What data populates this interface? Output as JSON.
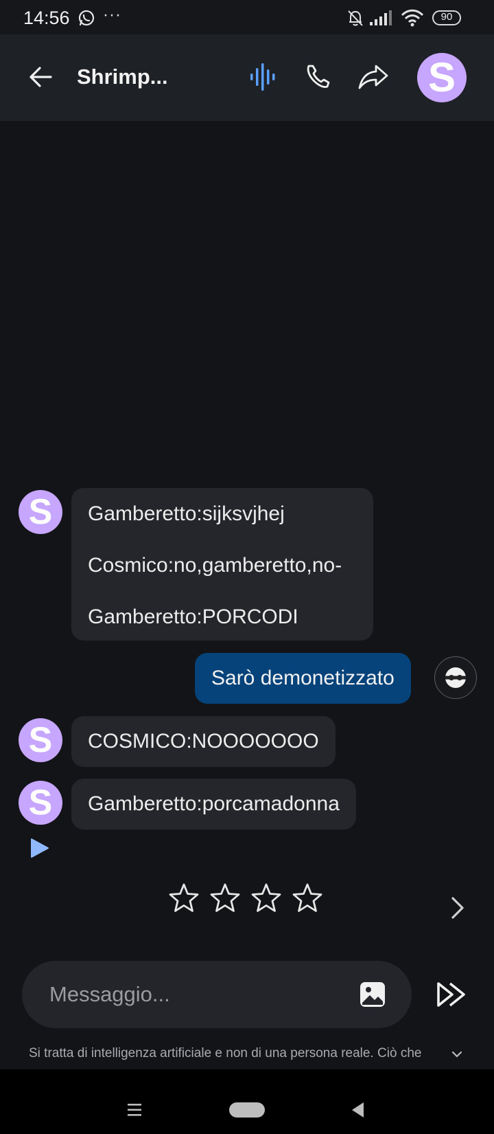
{
  "status_bar": {
    "time": "14:56",
    "dots": "···",
    "battery": "90",
    "icons": [
      "whatsapp-icon",
      "bell-off-icon",
      "signal-icon",
      "wifi-icon",
      "battery-icon"
    ]
  },
  "header": {
    "title": "Shrimp...",
    "avatar_letter": "S",
    "icons": [
      "back-arrow-icon",
      "voice-wave-icon",
      "phone-icon",
      "share-icon"
    ]
  },
  "messages": [
    {
      "from": "bot",
      "avatar_letter": "S",
      "lines": [
        "Gamberetto:sijksvjhej",
        "Cosmico:no,gamberetto,no-",
        "Gamberetto:PORCODI"
      ]
    },
    {
      "from": "user",
      "text": "Sarò demonetizzato"
    },
    {
      "from": "bot",
      "avatar_letter": "S",
      "lines": [
        "COSMICO:NOOOOOOO"
      ]
    },
    {
      "from": "bot",
      "avatar_letter": "S",
      "lines": [
        "Gamberetto:porcamadonna"
      ]
    }
  ],
  "rating": {
    "stars": 4,
    "selected": 0
  },
  "composer": {
    "placeholder": "Messaggio..."
  },
  "disclaimer": "Si tratta di intelligenza artificiale e non di una persona reale. Ciò che",
  "colors": {
    "background": "#131417",
    "bubble_bot": "#24262b",
    "bubble_user": "#05437a",
    "avatar": "#c7a6ff",
    "accent": "#5aa0ff"
  }
}
